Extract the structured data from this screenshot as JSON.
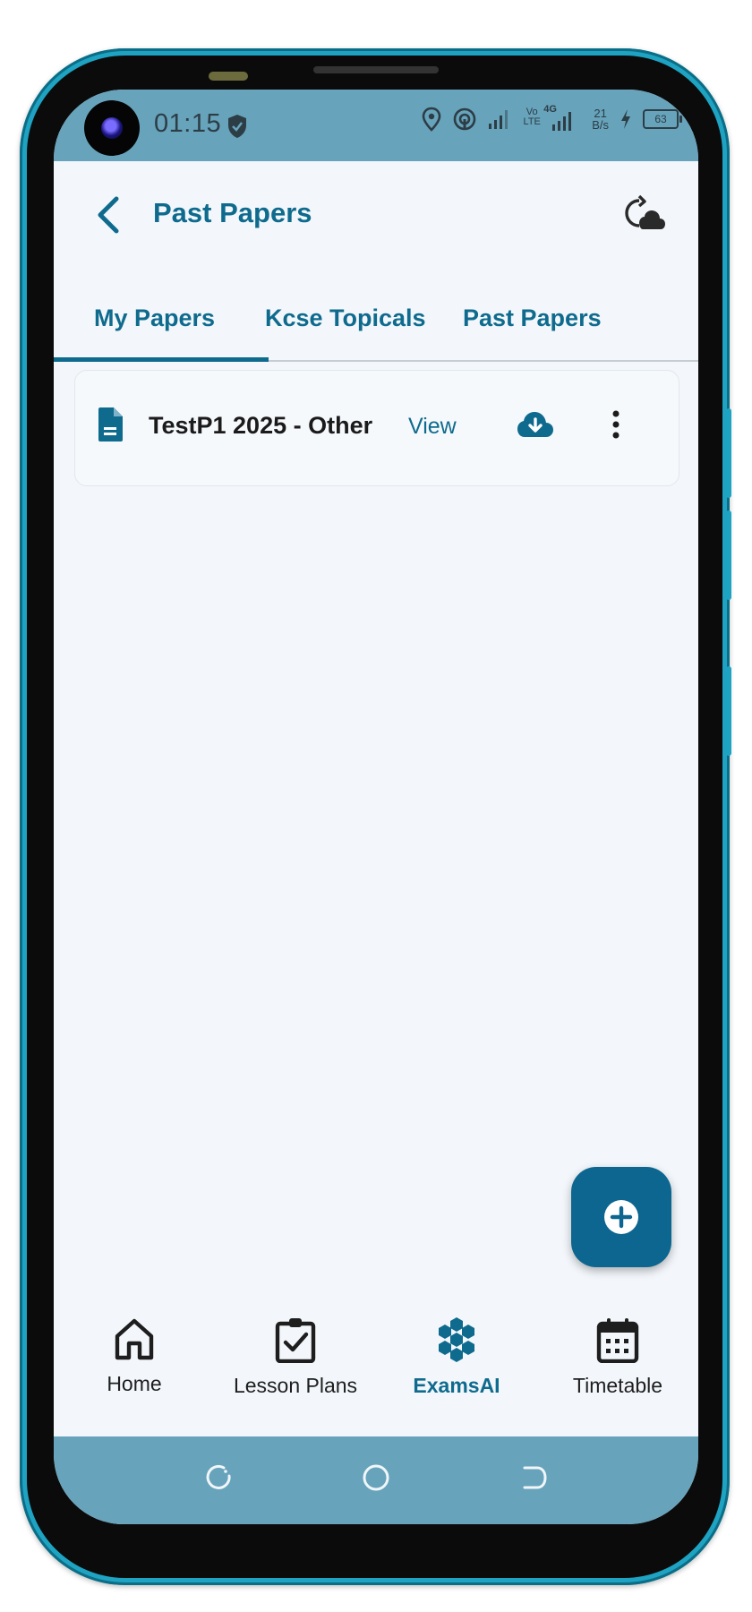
{
  "status_bar": {
    "time": "01:15",
    "network_type": "4G",
    "volte": "Vo LTE",
    "speed_value": "21",
    "speed_unit": "B/s",
    "battery": "63"
  },
  "app_bar": {
    "title": "Past Papers"
  },
  "tabs": [
    {
      "label": "My Papers",
      "active": true
    },
    {
      "label": "Kcse Topicals",
      "active": false
    },
    {
      "label": "Past Papers",
      "active": false
    }
  ],
  "papers": [
    {
      "name": "TestP1 2025 - Other",
      "action": "View"
    }
  ],
  "bottom_nav": [
    {
      "label": "Home",
      "icon": "home-icon",
      "active": false
    },
    {
      "label": "Lesson Plans",
      "icon": "clipboard-check-icon",
      "active": false
    },
    {
      "label": "ExamsAI",
      "icon": "hexagons-icon",
      "active": true
    },
    {
      "label": "Timetable",
      "icon": "calendar-icon",
      "active": false
    }
  ],
  "colors": {
    "primary": "#0f6b8e",
    "status_bar": "#67a3bb",
    "background": "#f3f7fb",
    "phone_frame": "#1fa3c2"
  }
}
